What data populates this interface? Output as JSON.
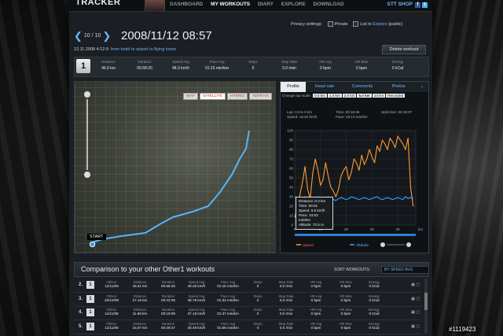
{
  "app": {
    "logo": "TRACKER",
    "nav": [
      "DASHBOARD",
      "MY WORKOUTS",
      "DIARY",
      "EXPLORE",
      "DOWNLOAD"
    ],
    "nav_active": "MY WORKOUTS",
    "shop": "STT SHOP",
    "fb": "f",
    "tw": "t"
  },
  "privacy": {
    "label": "Privacy settings:",
    "private": "Private",
    "list_prefix": "List in",
    "list_link": "Explore",
    "list_suffix": "(public)"
  },
  "workout": {
    "pager_text": "10 / 10",
    "title": "2008/11/12 08:57",
    "subtitle_time": "12.11.2008 4:12:9",
    "route": "from hotel to airport to flying home",
    "delete_label": "Delete workout"
  },
  "lap_number": "1",
  "stats": [
    {
      "label": "Distance",
      "value": "46.9 km"
    },
    {
      "label": "Duration",
      "value": "00:58:20"
    },
    {
      "label": "Speed Avg",
      "value": "48.3 km/h"
    },
    {
      "label": "Pace Avg",
      "value": "01:15 min/km"
    },
    {
      "label": "Steps",
      "value": "0"
    },
    {
      "label": "Step Rate",
      "value": "0.0 /min"
    },
    {
      "label": "HR Avg",
      "value": "0 bpm"
    },
    {
      "label": "HR Max",
      "value": "0 bpm"
    },
    {
      "label": "Energy",
      "value": "0 kCal"
    }
  ],
  "map": {
    "tabs": [
      "MAP",
      "SATELLITE",
      "HYBRID",
      "TERRAIN"
    ],
    "selected_tab": "SATELLITE",
    "start_label": "START"
  },
  "panel": {
    "tabs": [
      "Profile",
      "Heart rate",
      "Comments",
      "Photos"
    ],
    "selected_tab": "Profile",
    "lap_scale_label": "Change lap scale:",
    "lap_scale_options": [
      "0.5 km",
      "1.0 km",
      "2.0 km",
      "5.0 km",
      "10 km",
      "Recorded"
    ],
    "lap_scale_selected": "5.0 km",
    "info": {
      "lap": "Lap: 0.0-5.0 km",
      "time": "Time: 00:16:06",
      "split": "Split time: 00:16:07",
      "speed": "Speed: 18.63 km/h",
      "pace": "Pace: 03:13 min/km"
    },
    "tooltip": {
      "distance": "Distance: 0.0 km",
      "time": "Time: 00:01",
      "speed": "Speed: 5.5 km/h",
      "pace": "Pace: 10:53 min/km",
      "altitude": "Altitude: 72.5 m"
    },
    "legend": [
      "Speed",
      "Altitude"
    ]
  },
  "chart_data": {
    "type": "line",
    "xlabel": "km",
    "xlim": [
      0,
      47
    ],
    "xticks": [
      0,
      10,
      20,
      30,
      40
    ],
    "ylim": [
      0,
      100
    ],
    "yticks": [
      0,
      10,
      20,
      30,
      40,
      50,
      60,
      70,
      80,
      90,
      100
    ],
    "series": [
      {
        "name": "Speed",
        "color": "#ff9b2e",
        "x": [
          0,
          1,
          2,
          3,
          4,
          5,
          6,
          7,
          8,
          9,
          10,
          11,
          12,
          13,
          14,
          15,
          16,
          17,
          18,
          19,
          20,
          21,
          22,
          23,
          24,
          25,
          26,
          27,
          28,
          29,
          30,
          31,
          32,
          33,
          34,
          35,
          36,
          37,
          38,
          39,
          40,
          41,
          42,
          43,
          44,
          45,
          46
        ],
        "values": [
          8,
          18,
          32,
          45,
          62,
          38,
          28,
          55,
          70,
          58,
          42,
          48,
          66,
          52,
          40,
          36,
          30,
          38,
          52,
          58,
          62,
          48,
          56,
          70,
          66,
          58,
          74,
          64,
          70,
          80,
          72,
          66,
          84,
          78,
          90,
          86,
          80,
          92,
          88,
          82,
          94,
          90,
          86,
          80,
          92,
          40,
          20
        ]
      },
      {
        "name": "Altitude",
        "color": "#3aa0ff",
        "x": [
          0,
          1,
          2,
          3,
          4,
          5,
          6,
          7,
          8,
          9,
          10,
          11,
          12,
          13,
          14,
          15,
          16,
          17,
          18,
          19,
          20,
          21,
          22,
          23,
          24,
          25,
          26,
          27,
          28,
          29,
          30,
          31,
          32,
          33,
          34,
          35,
          36,
          37,
          38,
          39,
          40,
          41,
          42,
          43,
          44,
          45,
          46
        ],
        "values": [
          30,
          29,
          28,
          29,
          30,
          28,
          27,
          28,
          29,
          30,
          28,
          27,
          28,
          30,
          29,
          27,
          26,
          28,
          29,
          28,
          27,
          28,
          30,
          29,
          28,
          27,
          28,
          29,
          28,
          27,
          28,
          29,
          30,
          28,
          27,
          28,
          29,
          28,
          27,
          28,
          29,
          28,
          27,
          30,
          28,
          29,
          28
        ]
      }
    ]
  },
  "comparison": {
    "title": "Comparison to your other Other1 workouts",
    "sort_label": "SORT WORKOUTS:",
    "sort_value": "BY SPEED AVG",
    "columns": [
      "Other1",
      "Distance",
      "Duration",
      "Speed Avg",
      "Pace Avg",
      "Steps",
      "Step Rate",
      "HR Avg",
      "HR Max",
      "Energy"
    ],
    "rows": [
      {
        "rank": "2.",
        "values": [
          "12/11/08",
          "46.91 km",
          "00:58:20",
          "48.25 km/h",
          "01:15 min/km",
          "0",
          "0.0 /min",
          "0 bpm",
          "0 bpm",
          "0 kCal"
        ]
      },
      {
        "rank": "3.",
        "values": [
          "20/10/08",
          "27.16 km",
          "00:42:05",
          "38.76 km/h",
          "01:33 min/km",
          "0",
          "0.0 /min",
          "0 bpm",
          "0 bpm",
          "0 kCal"
        ]
      },
      {
        "rank": "4.",
        "values": [
          "11/11/08",
          "11.86 km",
          "00:19:08",
          "37.18 km/h",
          "01:37 min/km",
          "0",
          "0.0 /min",
          "0 bpm",
          "0 bpm",
          "0 kCal"
        ]
      },
      {
        "rank": "5.",
        "values": [
          "11/11/08",
          "15.07 km",
          "00:29:47",
          "30.49 km/h",
          "01:58 min/km",
          "0",
          "0.0 /min",
          "0 bpm",
          "0 bpm",
          "0 kCal"
        ]
      }
    ]
  },
  "watermark": "#1119423"
}
